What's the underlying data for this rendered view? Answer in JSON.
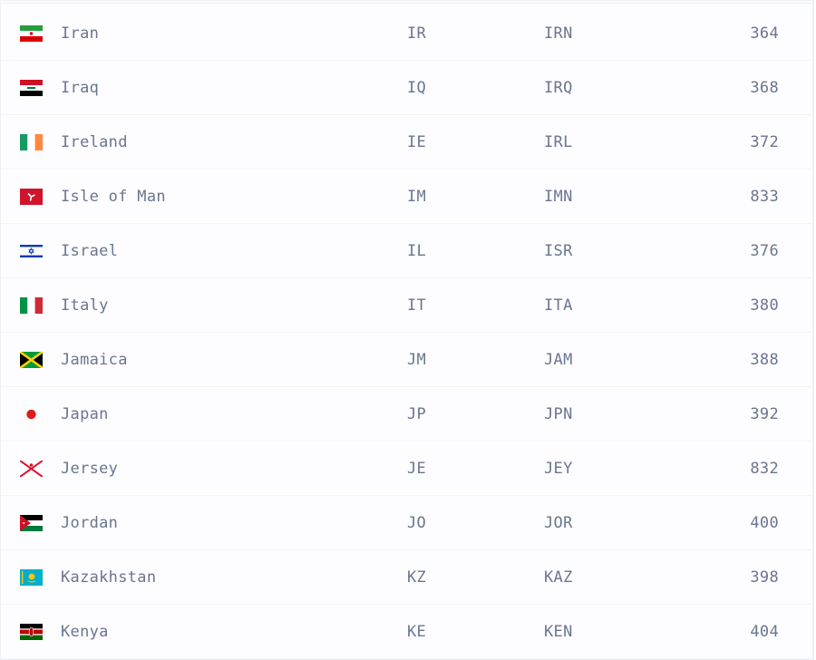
{
  "rows": [
    {
      "name": "Iran",
      "alpha2": "IR",
      "alpha3": "IRN",
      "numeric": "364",
      "flag_icon": "iran-flag-icon"
    },
    {
      "name": "Iraq",
      "alpha2": "IQ",
      "alpha3": "IRQ",
      "numeric": "368",
      "flag_icon": "iraq-flag-icon"
    },
    {
      "name": "Ireland",
      "alpha2": "IE",
      "alpha3": "IRL",
      "numeric": "372",
      "flag_icon": "ireland-flag-icon"
    },
    {
      "name": "Isle of Man",
      "alpha2": "IM",
      "alpha3": "IMN",
      "numeric": "833",
      "flag_icon": "isle-of-man-flag-icon"
    },
    {
      "name": "Israel",
      "alpha2": "IL",
      "alpha3": "ISR",
      "numeric": "376",
      "flag_icon": "israel-flag-icon"
    },
    {
      "name": "Italy",
      "alpha2": "IT",
      "alpha3": "ITA",
      "numeric": "380",
      "flag_icon": "italy-flag-icon"
    },
    {
      "name": "Jamaica",
      "alpha2": "JM",
      "alpha3": "JAM",
      "numeric": "388",
      "flag_icon": "jamaica-flag-icon"
    },
    {
      "name": "Japan",
      "alpha2": "JP",
      "alpha3": "JPN",
      "numeric": "392",
      "flag_icon": "japan-flag-icon"
    },
    {
      "name": "Jersey",
      "alpha2": "JE",
      "alpha3": "JEY",
      "numeric": "832",
      "flag_icon": "jersey-flag-icon"
    },
    {
      "name": "Jordan",
      "alpha2": "JO",
      "alpha3": "JOR",
      "numeric": "400",
      "flag_icon": "jordan-flag-icon"
    },
    {
      "name": "Kazakhstan",
      "alpha2": "KZ",
      "alpha3": "KAZ",
      "numeric": "398",
      "flag_icon": "kazakhstan-flag-icon"
    },
    {
      "name": "Kenya",
      "alpha2": "KE",
      "alpha3": "KEN",
      "numeric": "404",
      "flag_icon": "kenya-flag-icon"
    }
  ],
  "colors": {
    "text": "#6b7591",
    "row_border": "#f3f4f8",
    "background": "#fdfdff"
  }
}
